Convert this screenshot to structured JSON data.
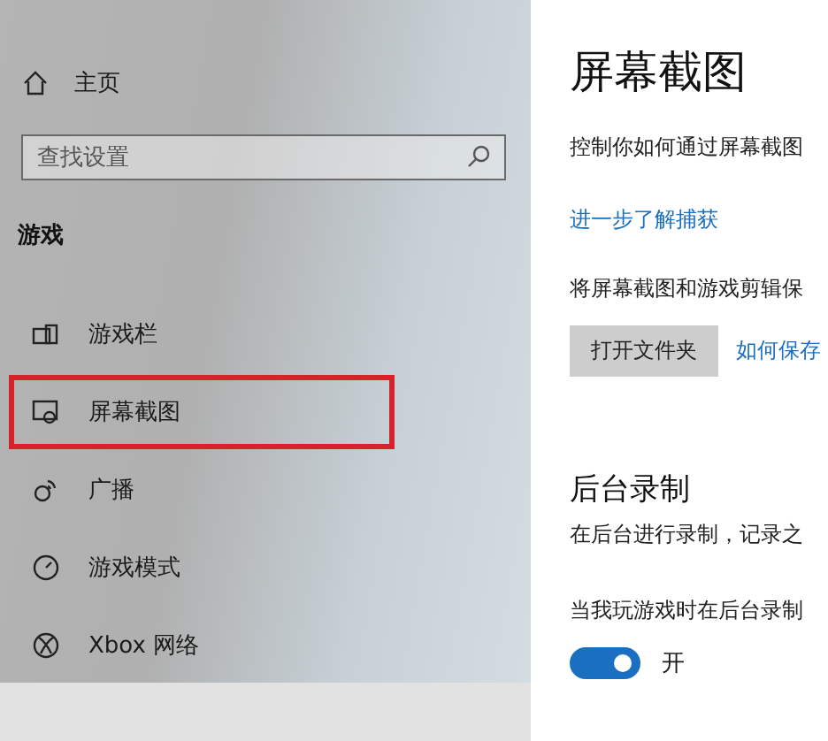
{
  "sidebar": {
    "home": {
      "label": "主页"
    },
    "search": {
      "placeholder": "查找设置"
    },
    "section": "游戏",
    "items": [
      {
        "kind": "bar",
        "label": "游戏栏",
        "highlighted": false
      },
      {
        "kind": "capture",
        "label": "屏幕截图",
        "highlighted": true
      },
      {
        "kind": "broadcast",
        "label": "广播",
        "highlighted": false
      },
      {
        "kind": "gauge",
        "label": "游戏模式",
        "highlighted": false
      },
      {
        "kind": "xbox",
        "label": "Xbox 网络",
        "highlighted": false
      }
    ]
  },
  "content": {
    "title": "屏幕截图",
    "description": "控制你如何通过屏幕截图",
    "learn_link": "进一步了解捕获",
    "save_text": "将屏幕截图和游戏剪辑保",
    "open_button": "打开文件夹",
    "save_link": "如何保存",
    "background": {
      "title": "后台录制",
      "description": "在后台进行录制，记录之",
      "setting_label": "当我玩游戏时在后台录制",
      "toggle": {
        "on": true,
        "label": "开"
      }
    }
  }
}
